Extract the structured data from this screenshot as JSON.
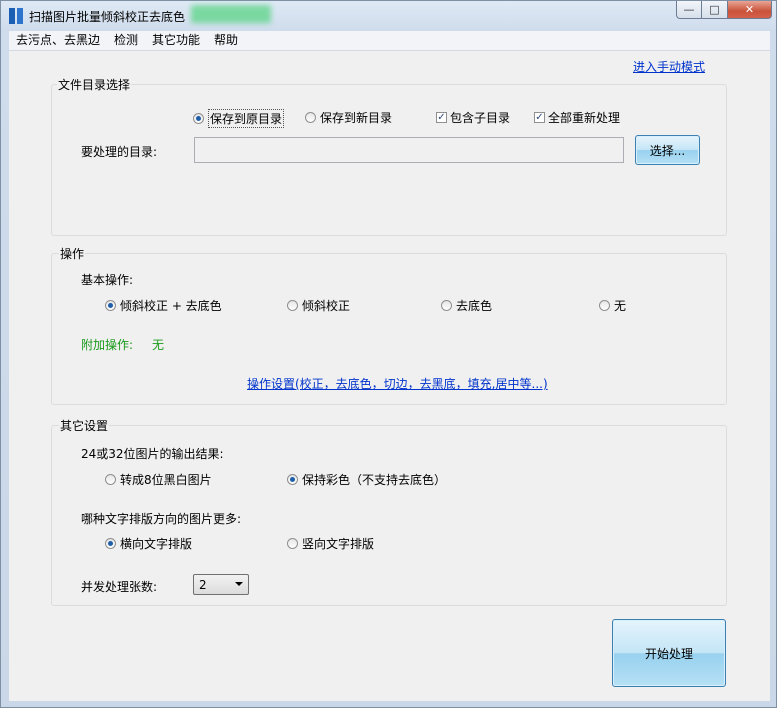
{
  "window": {
    "title": "扫描图片批量倾斜校正去底色",
    "minimize_glyph": "—",
    "maximize_glyph": "□",
    "close_glyph": "✕"
  },
  "menu": {
    "items": [
      "去污点、去黑边",
      "检测",
      "其它功能",
      "帮助"
    ]
  },
  "manual_mode_link": "进入手动模式",
  "file_dir": {
    "legend": "文件目录选择",
    "save_original": "保存到原目录",
    "save_new": "保存到新目录",
    "include_subdirs": "包含子目录",
    "reprocess_all": "全部重新处理",
    "dir_label": "要处理的目录:",
    "dir_value": "",
    "choose_button": "选择..."
  },
  "operation": {
    "legend": "操作",
    "basic_label": "基本操作:",
    "options": [
      "倾斜校正 + 去底色",
      "倾斜校正",
      "去底色",
      "无"
    ],
    "selected_index": 0,
    "extra_label": "附加操作:",
    "extra_value": "无",
    "settings_link": "操作设置(校正，去底色，切边，去黑底，填充,居中等...)"
  },
  "other": {
    "legend": "其它设置",
    "output_label": "24或32位图片的输出结果:",
    "output_options": [
      "转成8位黑白图片",
      "保持彩色（不支持去底色）"
    ],
    "output_selected": 1,
    "direction_label": "哪种文字排版方向的图片更多:",
    "direction_options": [
      "横向文字排版",
      "竖向文字排版"
    ],
    "direction_selected": 0,
    "concurrency_label": "并发处理张数:",
    "concurrency_value": "2"
  },
  "start_button": "开始处理",
  "colors": {
    "accent_green": "#1a9a1a",
    "link_blue": "#0033cc",
    "close_red": "#c9523a"
  }
}
